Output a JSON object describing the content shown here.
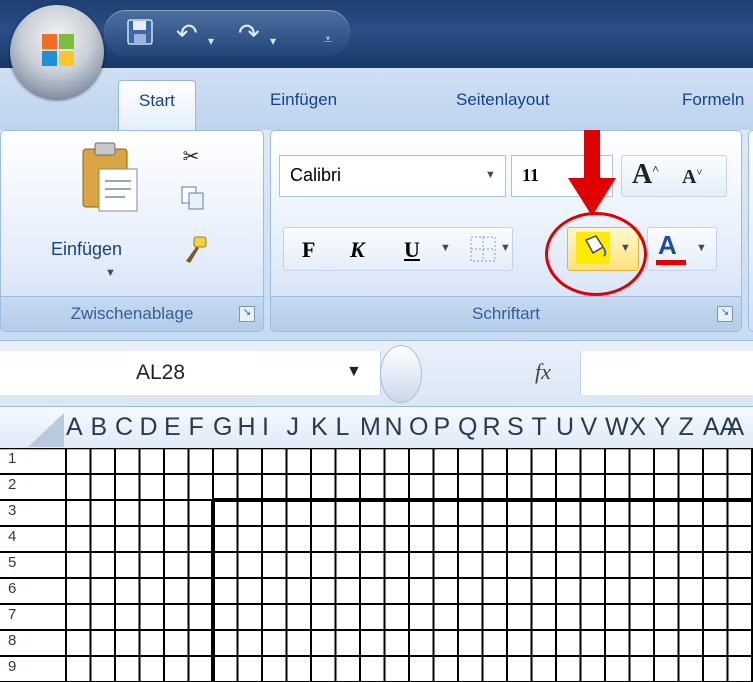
{
  "tabs": [
    {
      "label": "Start"
    },
    {
      "label": "Einfügen"
    },
    {
      "label": "Seitenlayout"
    },
    {
      "label": "Formeln"
    }
  ],
  "clipboard": {
    "paste_label": "Einfügen",
    "group_label": "Zwischenablage"
  },
  "font": {
    "font_name": "Calibri",
    "font_size": "11",
    "bold_label": "F",
    "italic_label": "K",
    "underline_label": "U",
    "grow_label": "A",
    "shrink_label": "A",
    "font_color_label": "A",
    "group_label": "Schriftart"
  },
  "formula": {
    "name_box": "AL28",
    "fx_label": "fx"
  },
  "columns": [
    "A",
    "B",
    "C",
    "D",
    "E",
    "F",
    "G",
    "H",
    "I",
    "J",
    "K",
    "L",
    "M",
    "N",
    "O",
    "P",
    "Q",
    "R",
    "S",
    "T",
    "U",
    "V",
    "W",
    "X",
    "Y",
    "Z",
    "AA",
    "A"
  ],
  "rows": [
    "1",
    "2",
    "3",
    "4",
    "5",
    "6",
    "7",
    "8",
    "9"
  ],
  "colors": {
    "highlight": "#ffea00",
    "font_color_bar": "#e60000",
    "annotation": "#e00000"
  },
  "icons": [
    "office-orb-icon",
    "save-icon",
    "undo-icon",
    "redo-icon",
    "customize-qat-icon",
    "paste-icon",
    "cut-icon",
    "copy-icon",
    "format-painter-icon",
    "fill-color-icon",
    "borders-icon",
    "function-icon"
  ]
}
